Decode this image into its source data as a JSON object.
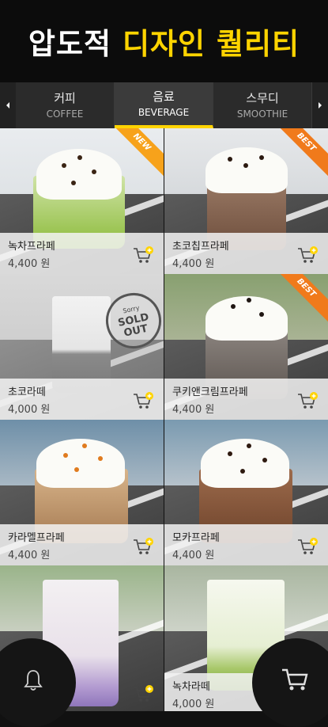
{
  "header": {
    "title_part1": "압도적",
    "title_part2": "디자인 퀄리티"
  },
  "tabs": [
    {
      "kr": "커피",
      "en": "COFFEE",
      "active": false
    },
    {
      "kr": "음료",
      "en": "BEVERAGE",
      "active": true
    },
    {
      "kr": "스무디",
      "en": "SMOOTHIE",
      "active": false
    }
  ],
  "products": [
    {
      "name": "녹차프라페",
      "price": "4,400  원",
      "badge": "NEW"
    },
    {
      "name": "초코칩프라페",
      "price": "4,400  원",
      "badge": "BEST"
    },
    {
      "name": "초코라떼",
      "price": "4,000  원",
      "badge": "",
      "soldout": "SOLD OUT",
      "stamp_text": "Sorry"
    },
    {
      "name": "쿠키앤크림프라페",
      "price": "4,400  원",
      "badge": "BEST"
    },
    {
      "name": "카라멜프라페",
      "price": "4,400  원",
      "badge": ""
    },
    {
      "name": "모카프라페",
      "price": "4,400  원",
      "badge": ""
    },
    {
      "name": "",
      "price": "",
      "badge": ""
    },
    {
      "name": "녹차라떼",
      "price": "4,000  원",
      "badge": ""
    }
  ],
  "colors": {
    "accent": "#ffd400",
    "badge_new": "#f7a21b",
    "badge_best": "#f07a1b"
  },
  "icons": {
    "tab_prev": "chevron-left-icon",
    "tab_next": "chevron-right-icon",
    "cart_add": "cart-plus-icon",
    "bell": "bell-icon",
    "cart": "cart-icon"
  }
}
